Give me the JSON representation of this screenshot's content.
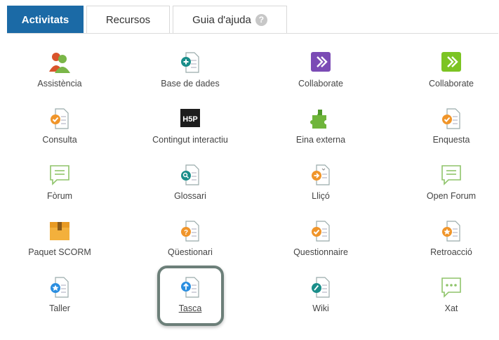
{
  "tabs": {
    "activities": "Activitats",
    "resources": "Recursos",
    "help_guide": "Guia d'ajuda",
    "help_icon": "?"
  },
  "items": [
    {
      "label": "Assistència",
      "icon": "attendance-icon"
    },
    {
      "label": "Base de dades",
      "icon": "database-icon"
    },
    {
      "label": "Collaborate",
      "icon": "collaborate-purple-icon"
    },
    {
      "label": "Collaborate",
      "icon": "collaborate-green-icon"
    },
    {
      "label": "Consulta",
      "icon": "choice-icon"
    },
    {
      "label": "Contingut interactiu",
      "icon": "h5p-icon",
      "icon_text": "H5P"
    },
    {
      "label": "Eina externa",
      "icon": "puzzle-icon"
    },
    {
      "label": "Enquesta",
      "icon": "survey-icon"
    },
    {
      "label": "Fòrum",
      "icon": "forum-icon"
    },
    {
      "label": "Glossari",
      "icon": "glossary-icon"
    },
    {
      "label": "Lliçó",
      "icon": "lesson-icon"
    },
    {
      "label": "Open Forum",
      "icon": "open-forum-icon"
    },
    {
      "label": "Paquet SCORM",
      "icon": "scorm-package-icon"
    },
    {
      "label": "Qüestionari",
      "icon": "quiz-icon"
    },
    {
      "label": "Questionnaire",
      "icon": "questionnaire-icon"
    },
    {
      "label": "Retroacció",
      "icon": "feedback-icon"
    },
    {
      "label": "Taller",
      "icon": "workshop-icon"
    },
    {
      "label": "Tasca",
      "icon": "assignment-icon"
    },
    {
      "label": "Wiki",
      "icon": "wiki-icon"
    },
    {
      "label": "Xat",
      "icon": "chat-icon"
    }
  ],
  "colors": {
    "tab_active": "#1b6aa6",
    "focus_ring": "#6c7f79",
    "orange": "#f0952a",
    "teal": "#1a8e8a",
    "blue": "#2a8ee0"
  }
}
